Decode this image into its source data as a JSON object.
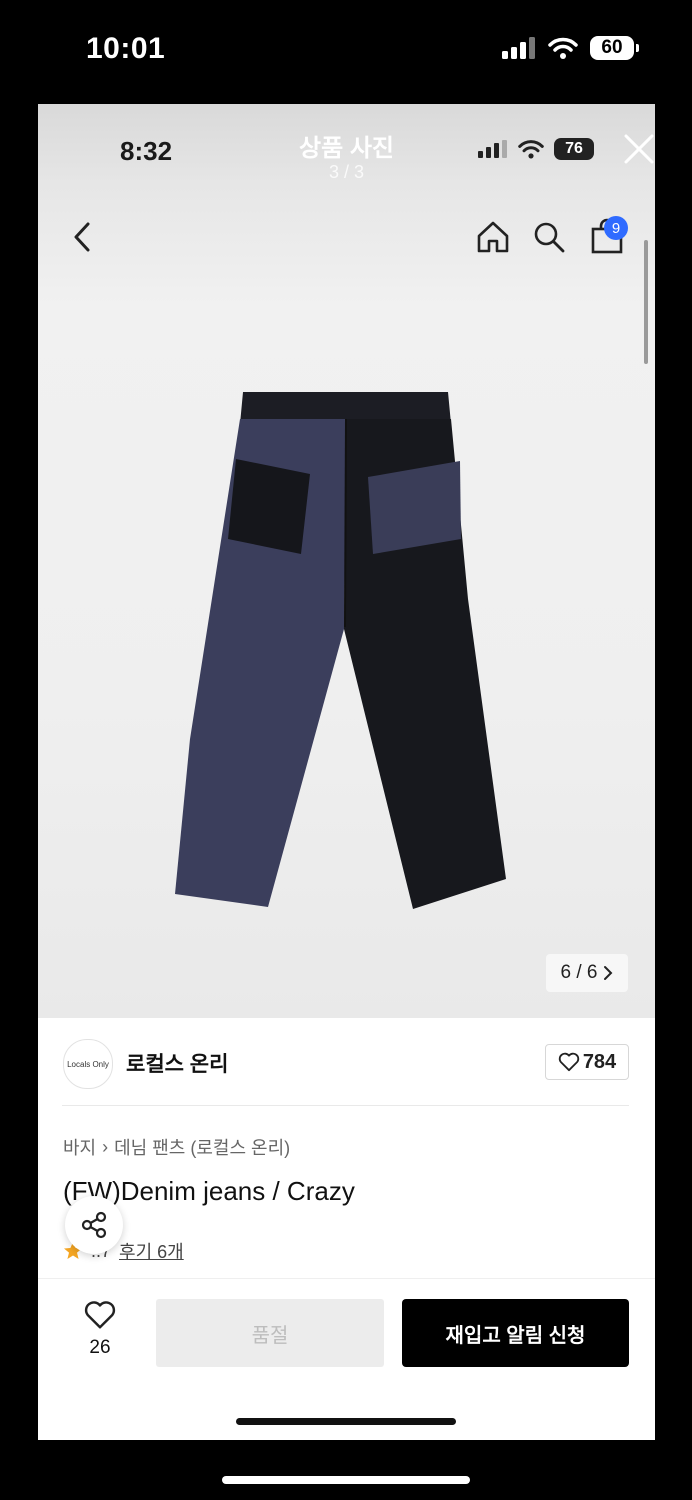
{
  "outer_status": {
    "time": "10:01",
    "battery": "60"
  },
  "viewer": {
    "title": "상품 사진",
    "count": "3 / 3",
    "inner_time": "8:32",
    "inner_battery": "76",
    "cart_badge": "9"
  },
  "photo": {
    "counter": "6 / 6"
  },
  "product": {
    "brand": "로컬스 온리",
    "brand_logo_text": "Locals Only",
    "likes": "784",
    "breadcrumb": {
      "category": "바지",
      "separator": "›",
      "subcategory": "데님 팬츠 (로컬스 온리)"
    },
    "title": "(FW)Denim jeans / Crazy",
    "rating": "..7",
    "reviews": "후기 6개"
  },
  "bottom_bar": {
    "wish_count": "26",
    "soldout_label": "품절",
    "restock_label": "재입고 알림 신청"
  }
}
